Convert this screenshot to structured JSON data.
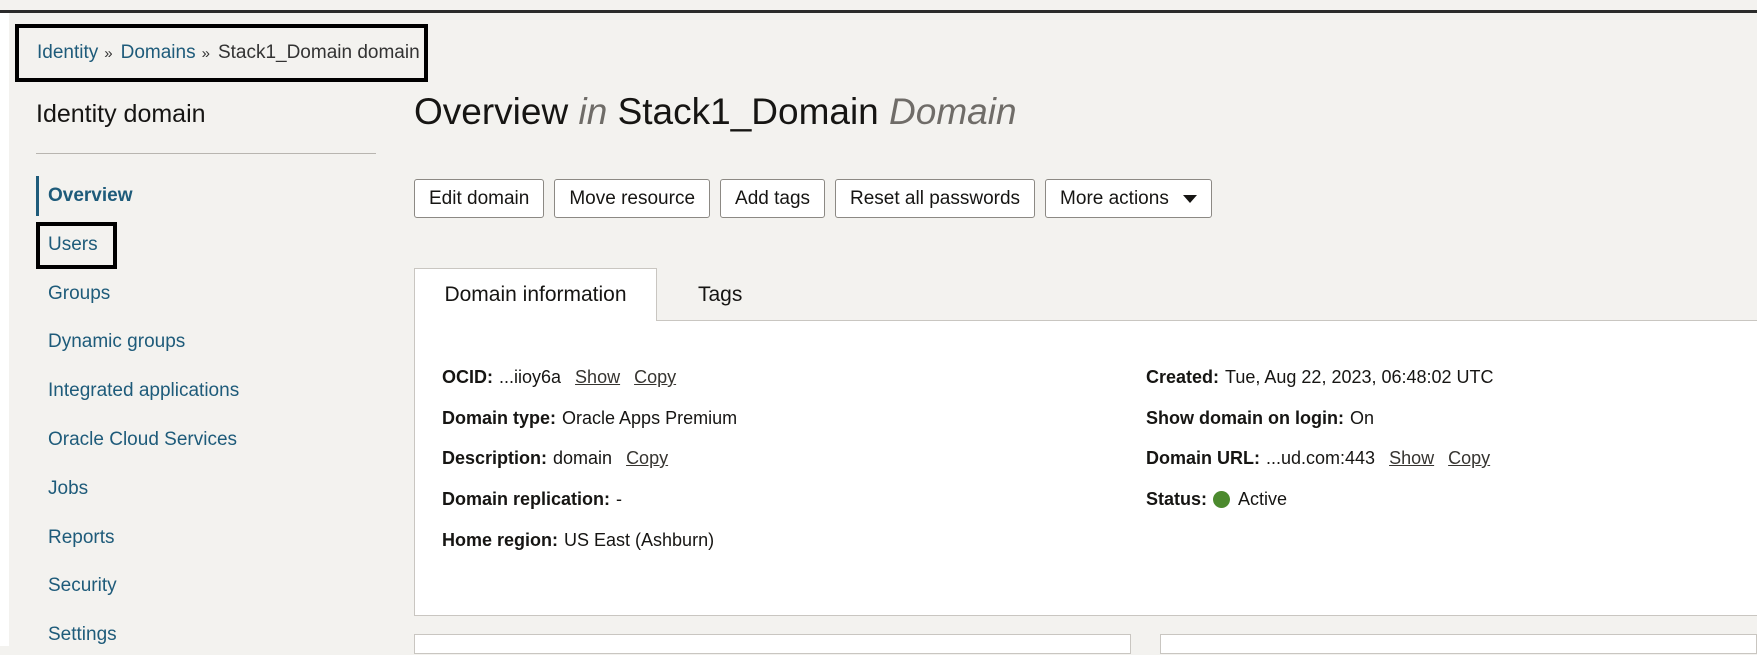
{
  "breadcrumb": {
    "items": [
      "Identity",
      "Domains"
    ],
    "current": "Stack1_Domain domain",
    "separator": "»"
  },
  "sidebar": {
    "title": "Identity domain",
    "items": [
      {
        "label": "Overview"
      },
      {
        "label": "Users"
      },
      {
        "label": "Groups"
      },
      {
        "label": "Dynamic groups"
      },
      {
        "label": "Integrated applications"
      },
      {
        "label": "Oracle Cloud Services"
      },
      {
        "label": "Jobs"
      },
      {
        "label": "Reports"
      },
      {
        "label": "Security"
      },
      {
        "label": "Settings"
      }
    ]
  },
  "header": {
    "title_a": "Overview ",
    "title_in": "in",
    "title_b": " Stack1_Domain ",
    "title_domain": "Domain"
  },
  "actions": {
    "edit": "Edit domain",
    "move": "Move resource",
    "tags": "Add tags",
    "reset": "Reset all passwords",
    "more": "More actions"
  },
  "tabs": {
    "info": "Domain information",
    "tags": "Tags"
  },
  "info": {
    "ocid_label": "OCID:",
    "ocid_value": "...iioy6a",
    "domain_type_label": "Domain type:",
    "domain_type_value": "Oracle Apps Premium",
    "description_label": "Description:",
    "description_value": "domain",
    "replication_label": "Domain replication:",
    "replication_value": "-",
    "home_region_label": "Home region:",
    "home_region_value": "US East (Ashburn)",
    "created_label": "Created:",
    "created_value": "Tue, Aug 22, 2023, 06:48:02 UTC",
    "show_login_label": "Show domain on login:",
    "show_login_value": "On",
    "url_label": "Domain URL:",
    "url_value": "...ud.com:443",
    "status_label": "Status:",
    "status_value": "Active",
    "show": "Show",
    "copy": "Copy"
  },
  "colors": {
    "link": "#1e5b7a",
    "status_active": "#4c8a2e"
  }
}
